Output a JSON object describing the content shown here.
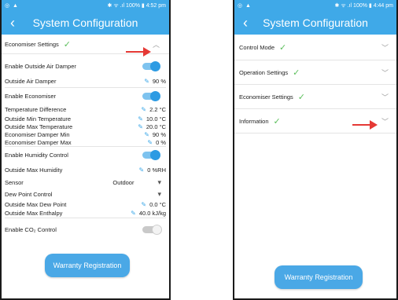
{
  "left": {
    "status": {
      "left_icons": "◎ ▲",
      "right": "✱ ᯤ .ıl 100% ▮ 4:52 pm"
    },
    "app_title": "System Configuration",
    "section_title": "Economiser Settings",
    "rows": [
      {
        "label": "Enable Outside Air Damper",
        "type": "toggle",
        "on": true
      },
      {
        "label": "Outside Air Damper",
        "type": "value",
        "value": "90 %"
      },
      {
        "label": "Enable Economiser",
        "type": "toggle",
        "on": true
      },
      {
        "label": "Temperature Difference",
        "type": "value",
        "value": "2.2 °C"
      },
      {
        "label": "Outside Min Temperature",
        "type": "value",
        "value": "10.0 °C"
      },
      {
        "label": "Outside Max Temperature",
        "type": "value",
        "value": "20.0 °C"
      },
      {
        "label": "Economiser Damper Min",
        "type": "value",
        "value": "90 %"
      },
      {
        "label": "Economiser Damper Max",
        "type": "value",
        "value": "0 %"
      },
      {
        "label": "Enable Humidity Control",
        "type": "toggle",
        "on": true
      },
      {
        "label": "Outside Max Humidity",
        "type": "value",
        "value": "0 %RH"
      },
      {
        "label": "Sensor",
        "type": "select",
        "value": "Outdoor"
      },
      {
        "label": "Dew Point Control",
        "type": "select",
        "value": ""
      },
      {
        "label": "Outside Max Dew Point",
        "type": "value",
        "value": "0.0 °C"
      },
      {
        "label": "Outside Max Enthalpy",
        "type": "value",
        "value": "40.0 kJ/kg"
      },
      {
        "label": "Enable CO₂ Control",
        "type": "toggle",
        "on": false
      }
    ],
    "button": "Warranty Registration"
  },
  "right": {
    "status": {
      "left_icons": "◎ ▲",
      "right": "✱ ᯤ .ıl 100% ▮ 4:44 pm"
    },
    "app_title": "System Configuration",
    "sections": [
      "Control Mode",
      "Operation Settings",
      "Economiser Settings",
      "Information"
    ],
    "button": "Warranty Registration"
  },
  "colors": {
    "accent": "#3fa9e8",
    "check": "#5cbf5c",
    "arrow": "#e53935"
  }
}
